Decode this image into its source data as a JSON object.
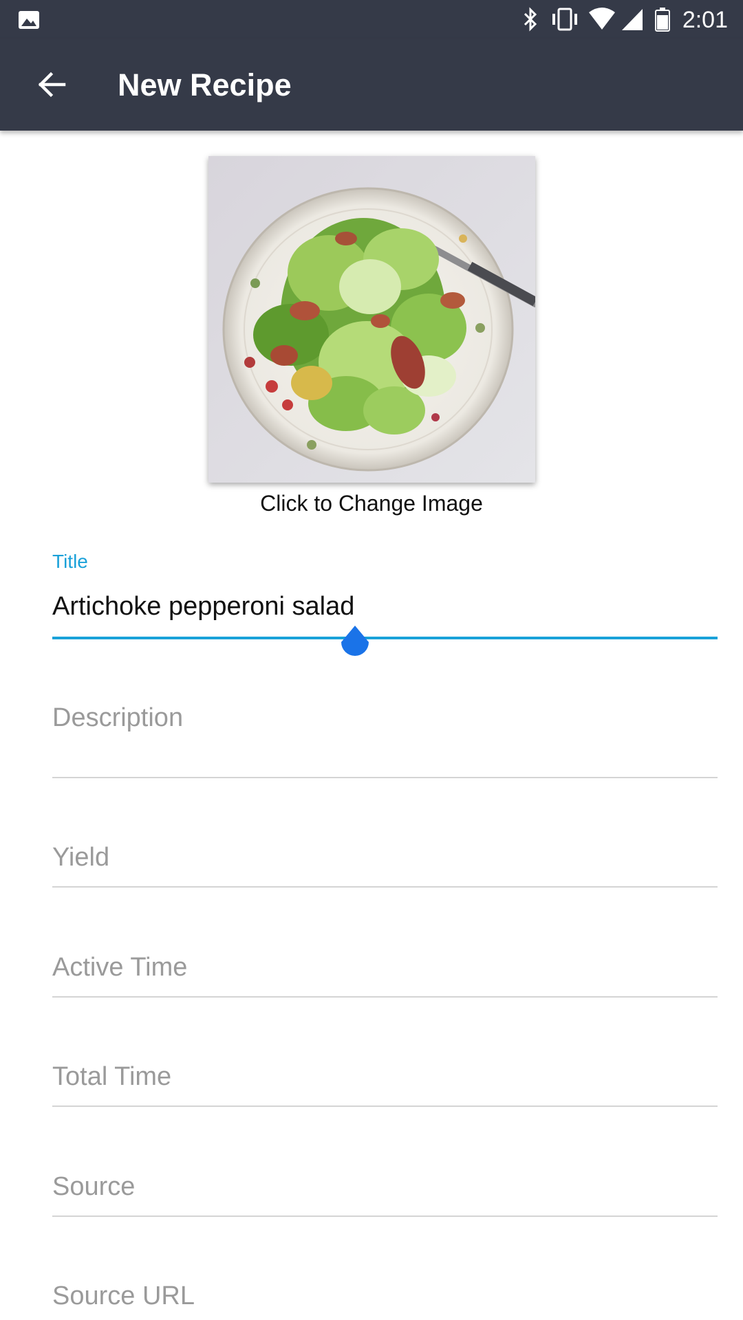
{
  "status_bar": {
    "time": "2:01",
    "icons": [
      "gallery-icon",
      "bluetooth-icon",
      "vibrate-icon",
      "wifi-icon",
      "signal-icon",
      "battery-icon"
    ]
  },
  "app_bar": {
    "title": "New Recipe",
    "back_icon": "arrow-back-icon"
  },
  "recipe_image": {
    "caption": "Click to Change Image"
  },
  "form": {
    "title": {
      "label": "Title",
      "value": "Artichoke pepperoni salad"
    },
    "description": {
      "placeholder": "Description"
    },
    "yield": {
      "placeholder": "Yield"
    },
    "active_time": {
      "placeholder": "Active Time"
    },
    "total_time": {
      "placeholder": "Total Time"
    },
    "source": {
      "placeholder": "Source"
    },
    "source_url": {
      "placeholder": "Source URL"
    }
  },
  "colors": {
    "app_bar": "#353a48",
    "accent": "#1aa1d9",
    "cursor_handle": "#1a73e8",
    "placeholder": "#9a9a9a"
  }
}
